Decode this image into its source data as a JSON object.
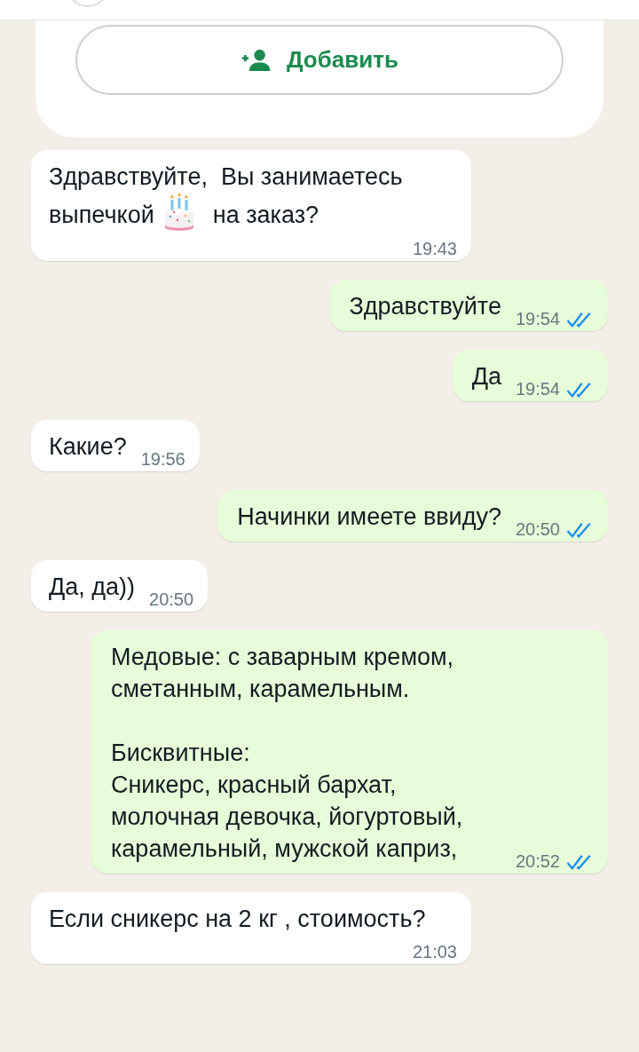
{
  "add_button": {
    "label": "Добавить"
  },
  "messages": [
    {
      "kind": "incoming",
      "parts": [
        "Здравствуйте,  Вы занимаетесь",
        [
          "выпечкой",
          "на заказ?"
        ]
      ],
      "time": "19:43"
    },
    {
      "kind": "outgoing",
      "parts": [
        "Здравствуйте"
      ],
      "time": "19:54",
      "read": true
    },
    {
      "kind": "outgoing",
      "parts": [
        "Да"
      ],
      "time": "19:54",
      "read": true
    },
    {
      "kind": "incoming",
      "parts": [
        "Какие?"
      ],
      "time": "19:56"
    },
    {
      "kind": "outgoing",
      "parts": [
        "Начинки имеете ввиду?"
      ],
      "time": "20:50",
      "read": true
    },
    {
      "kind": "incoming",
      "parts": [
        "Да, да))"
      ],
      "time": "20:50"
    },
    {
      "kind": "outgoing",
      "parts": [
        "Медовые: с заварным кремом, сметанным, карамельным.\n\nБисквитные:\nСникерс, красный бархат, молочная девочка, йогуртовый, карамельный, мужской каприз,"
      ],
      "time": "20:52",
      "read": true
    },
    {
      "kind": "incoming",
      "parts": [
        "Если сникерс на 2 кг , стоимость?"
      ],
      "time": "21:03"
    }
  ]
}
